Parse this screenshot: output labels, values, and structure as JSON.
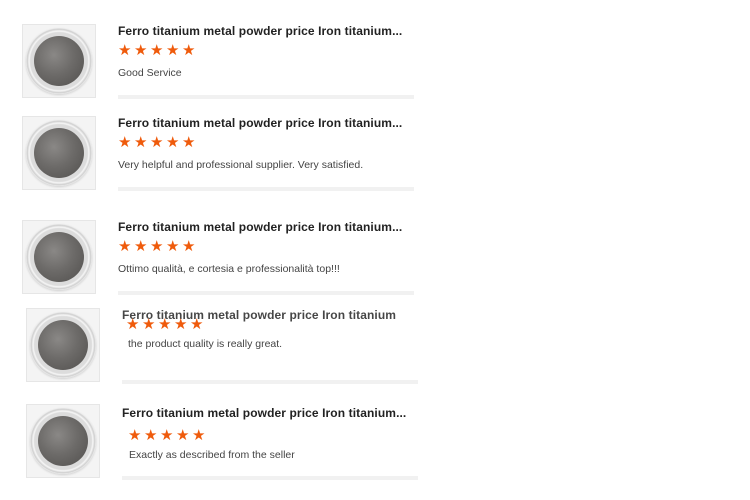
{
  "reviews": [
    {
      "product_title": "Ferro titanium metal powder price Iron titanium...",
      "rating": 5,
      "comment": "Good Service",
      "thumbnail_icon": "powder-dish-image"
    },
    {
      "product_title": "Ferro titanium metal powder price Iron titanium...",
      "rating": 5,
      "comment": "Very helpful and professional supplier. Very satisfied.",
      "thumbnail_icon": "powder-dish-image"
    },
    {
      "product_title": "Ferro titanium metal powder price Iron titanium...",
      "rating": 5,
      "comment": "Ottimo qualità, e cortesia e professionalità top!!!",
      "thumbnail_icon": "powder-dish-image"
    },
    {
      "product_title": "Ferro titanium metal powder price Iron titanium",
      "rating": 5,
      "comment": "the product quality is really great.",
      "thumbnail_icon": "powder-dish-image"
    },
    {
      "product_title": "Ferro titanium metal powder price Iron titanium...",
      "rating": 5,
      "comment": "Exactly as described from the seller",
      "thumbnail_icon": "powder-dish-image"
    }
  ],
  "colors": {
    "star": "#ef5b0c",
    "title": "#222222",
    "comment": "#444444"
  }
}
